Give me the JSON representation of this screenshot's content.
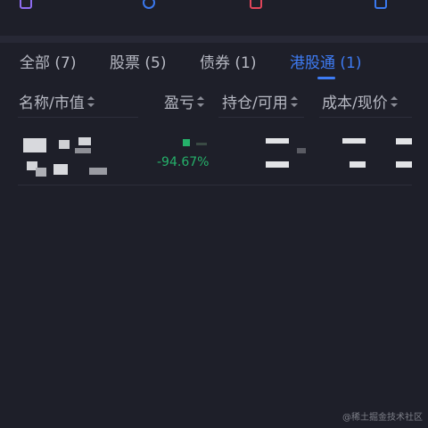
{
  "tabs": [
    {
      "label": "全部 (7)"
    },
    {
      "label": "股票 (5)"
    },
    {
      "label": "债券 (1)"
    },
    {
      "label": "港股通 (1)"
    }
  ],
  "active_tab_index": 3,
  "columns": [
    {
      "label": "名称/市值"
    },
    {
      "label": "盈亏"
    },
    {
      "label": "持仓/可用"
    },
    {
      "label": "成本/现价"
    }
  ],
  "rows": [
    {
      "pnl_percent": "-94.67%"
    }
  ],
  "watermark": "@稀土掘金技术社区",
  "colors": {
    "background": "#1e1f29",
    "accent": "#3e7cf5",
    "loss_green": "#25b06a",
    "text": "#b7b9c3"
  }
}
